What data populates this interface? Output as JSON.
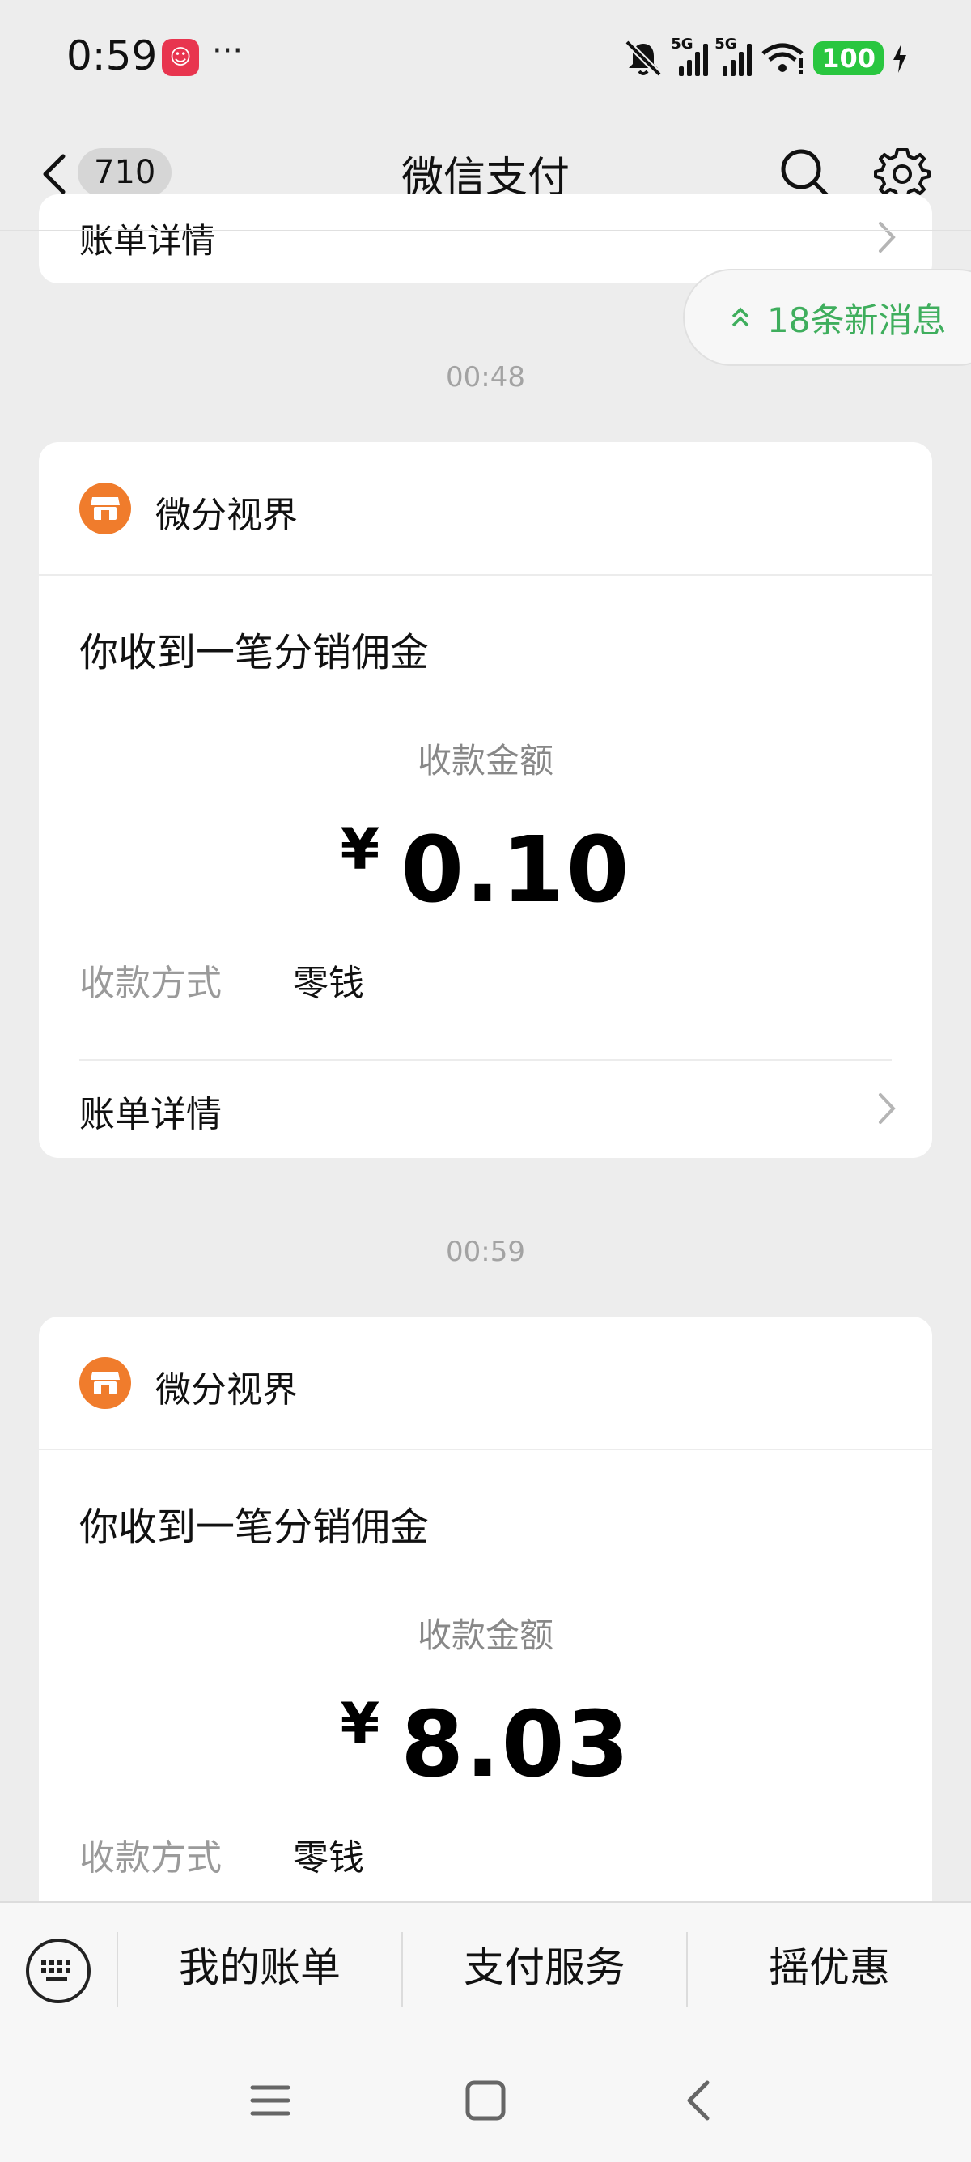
{
  "status_bar": {
    "time": "0:59",
    "dots": "···",
    "net1": "5G",
    "net2": "5G",
    "battery": "100"
  },
  "header": {
    "unread_count": "710",
    "title": "微信支付"
  },
  "partial_card": {
    "detail_label": "账单详情"
  },
  "new_messages": {
    "label": "18条新消息"
  },
  "messages": [
    {
      "time": "00:48",
      "merchant": "微分视界",
      "title": "你收到一笔分销佣金",
      "amount_label": "收款金额",
      "currency": "¥",
      "amount": "0.10",
      "method_label": "收款方式",
      "method_value": "零钱",
      "detail_label": "账单详情"
    },
    {
      "time": "00:59",
      "merchant": "微分视界",
      "title": "你收到一笔分销佣金",
      "amount_label": "收款金额",
      "currency": "¥",
      "amount": "8.03",
      "method_label": "收款方式",
      "method_value": "零钱"
    }
  ],
  "bottom_menu": {
    "items": [
      "我的账单",
      "支付服务",
      "摇优惠"
    ]
  },
  "colors": {
    "background": "#ededed",
    "accent_green": "#3fae5d",
    "merchant_orange": "#f07c2c",
    "battery_green": "#29c63f"
  }
}
